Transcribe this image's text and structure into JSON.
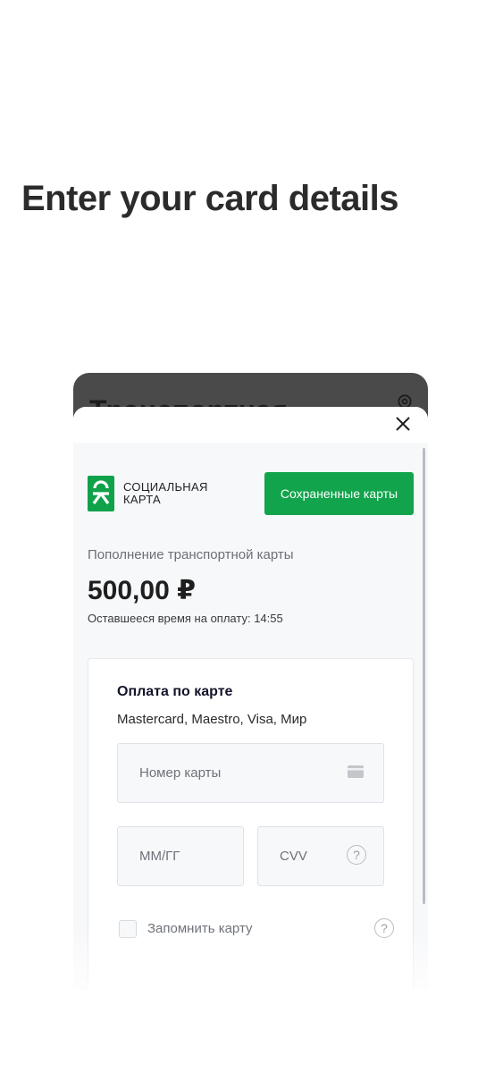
{
  "hero": {
    "title": "Enter your card details"
  },
  "background_screen": {
    "title": "Транспортная"
  },
  "brand": {
    "line1": "СОЦИАЛЬНАЯ",
    "line2": "КАРТА",
    "accent_color": "#12a44c"
  },
  "saved_cards_button": {
    "label": "Сохраненные карты"
  },
  "payment": {
    "topup_label": "Пополнение транспортной карты",
    "amount": "500,00 ₽",
    "timer_label": "Оставшееся время на оплату: 14:55"
  },
  "card_form": {
    "title": "Оплата по карте",
    "accepted": "Mastercard, Maestro, Visa, Мир",
    "card_number": {
      "placeholder": "Номер карты",
      "value": ""
    },
    "expiry": {
      "placeholder": "ММ/ГГ",
      "value": ""
    },
    "cvv": {
      "placeholder": "CVV",
      "value": ""
    },
    "remember_label": "Запомнить карту",
    "help_glyph": "?"
  },
  "icons": {
    "close": "close-icon",
    "gear": "gear-icon",
    "card": "credit-card-icon",
    "help": "question-circle-icon"
  }
}
